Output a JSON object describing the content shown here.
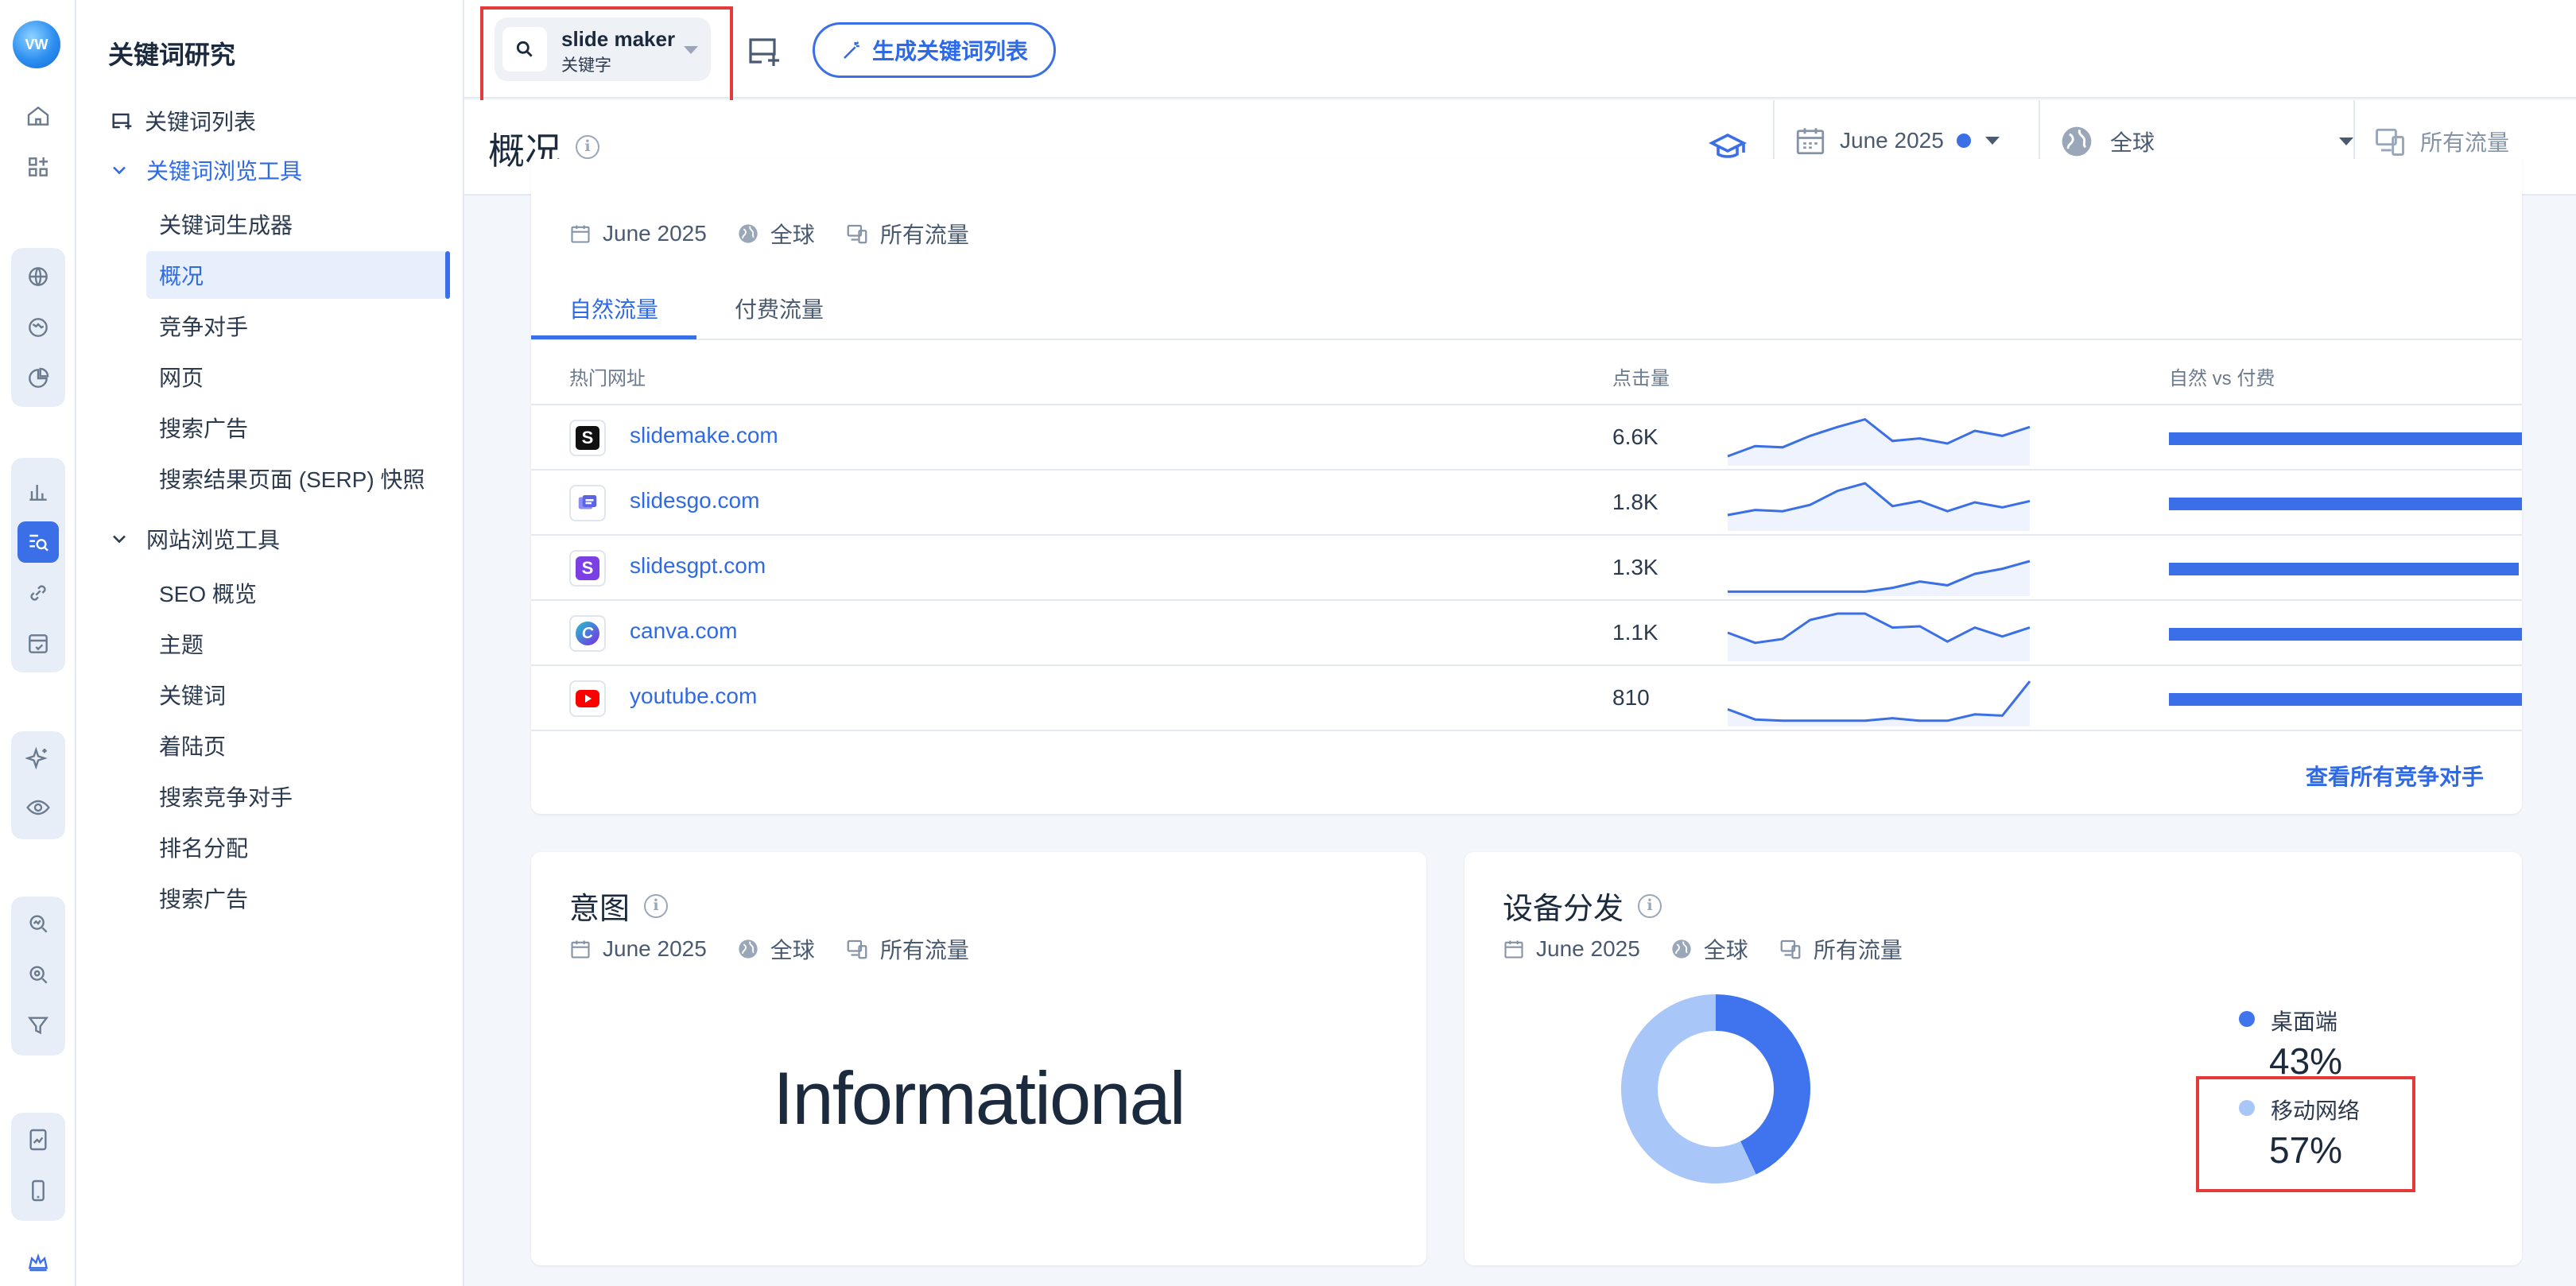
{
  "sidebar": {
    "title": "关键词研究",
    "keyword_list": "关键词列表",
    "keyword_tools": {
      "label": "关键词浏览工具",
      "items": [
        "关键词生成器",
        "概况",
        "竞争对手",
        "网页",
        "搜索广告",
        "搜索结果页面 (SERP) 快照"
      ]
    },
    "website_tools": {
      "label": "网站浏览工具",
      "items": [
        "SEO 概览",
        "主题",
        "关键词",
        "着陆页",
        "搜索竞争对手",
        "排名分配",
        "搜索广告"
      ]
    }
  },
  "topbar": {
    "keyword": "slide maker",
    "keyword_type": "关键字",
    "generate_button": "生成关键词列表"
  },
  "page": {
    "title": "概况",
    "date": "June 2025",
    "region": "全球",
    "traffic": "所有流量"
  },
  "top_sites": {
    "meta": {
      "date": "June 2025",
      "region": "全球",
      "traffic": "所有流量"
    },
    "tabs": [
      "自然流量",
      "付费流量"
    ],
    "columns": {
      "site": "热门网址",
      "clicks": "点击量",
      "ratio": "自然 vs 付费"
    },
    "rows": [
      {
        "name": "slidemake.com",
        "clicks": "6.6K",
        "organic_share": 1.0,
        "trend": [
          10,
          26,
          24,
          42,
          56,
          68,
          34,
          38,
          30,
          50,
          42,
          56
        ]
      },
      {
        "name": "slidesgo.com",
        "clicks": "1.8K",
        "organic_share": 1.0,
        "trend": [
          20,
          28,
          26,
          36,
          58,
          70,
          34,
          42,
          26,
          40,
          32,
          42
        ]
      },
      {
        "name": "slidesgpt.com",
        "clicks": "1.3K",
        "organic_share": 0.99,
        "trend": [
          2,
          2,
          2,
          2,
          2,
          2,
          8,
          18,
          12,
          30,
          38,
          50
        ]
      },
      {
        "name": "canva.com",
        "clicks": "1.1K",
        "organic_share": 1.0,
        "trend": [
          40,
          24,
          30,
          60,
          70,
          70,
          48,
          50,
          26,
          48,
          34,
          48
        ]
      },
      {
        "name": "youtube.com",
        "clicks": "810",
        "organic_share": 1.0,
        "trend": [
          22,
          6,
          4,
          4,
          4,
          4,
          8,
          4,
          4,
          14,
          12,
          66
        ]
      }
    ],
    "see_all": "查看所有竞争对手"
  },
  "intent": {
    "title": "意图",
    "meta": {
      "date": "June 2025",
      "region": "全球",
      "traffic": "所有流量"
    },
    "value": "Informational"
  },
  "device": {
    "title": "设备分发",
    "meta": {
      "date": "June 2025",
      "region": "全球",
      "traffic": "所有流量"
    },
    "desktop": {
      "label": "桌面端",
      "pct": "43%",
      "value": 43,
      "color": "#3f74ee"
    },
    "mobile": {
      "label": "移动网络",
      "pct": "57%",
      "value": 57,
      "color": "#a9c6f8"
    }
  },
  "colors": {
    "accent": "#3a6fe8",
    "highlight": "#e53a3a"
  }
}
